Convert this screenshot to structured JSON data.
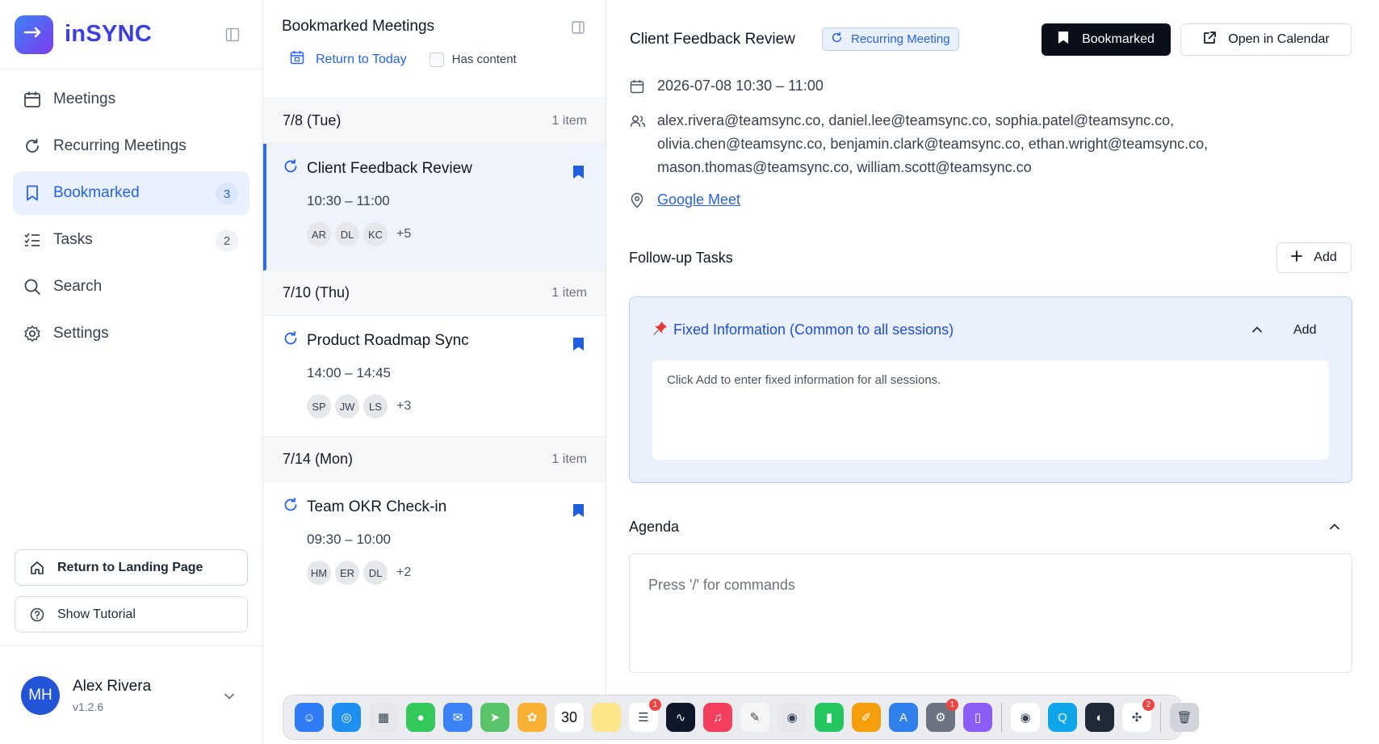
{
  "app": {
    "name": "inSYNC"
  },
  "sidebar": {
    "items": [
      {
        "label": "Meetings",
        "icon": "calendar-icon"
      },
      {
        "label": "Recurring Meetings",
        "icon": "refresh-icon"
      },
      {
        "label": "Bookmarked",
        "icon": "bookmark-icon",
        "badge": "3",
        "active": true
      },
      {
        "label": "Tasks",
        "icon": "checklist-icon",
        "badge": "2"
      },
      {
        "label": "Search",
        "icon": "search-icon"
      },
      {
        "label": "Settings",
        "icon": "gear-icon"
      }
    ],
    "landing_label": "Return to Landing Page",
    "tutorial_label": "Show Tutorial",
    "user": {
      "initials": "MH",
      "name": "Alex Rivera",
      "version": "v1.2.6"
    }
  },
  "list": {
    "title": "Bookmarked Meetings",
    "today_label": "Return to Today",
    "has_content_label": "Has content",
    "groups": [
      {
        "date": "7/8 (Tue)",
        "count": "1 item",
        "meeting": {
          "title": "Client Feedback Review",
          "time": "10:30 – 11:00",
          "avatars": [
            "AR",
            "DL",
            "KC"
          ],
          "more": "+5"
        }
      },
      {
        "date": "7/10 (Thu)",
        "count": "1 item",
        "meeting": {
          "title": "Product Roadmap Sync",
          "time": "14:00 – 14:45",
          "avatars": [
            "SP",
            "JW",
            "LS"
          ],
          "more": "+3"
        }
      },
      {
        "date": "7/14 (Mon)",
        "count": "1 item",
        "meeting": {
          "title": "Team OKR Check-in",
          "time": "09:30 – 10:00",
          "avatars": [
            "HM",
            "ER",
            "DL"
          ],
          "more": "+2"
        }
      }
    ]
  },
  "detail": {
    "title": "Client Feedback Review",
    "recurring_label": "Recurring Meeting",
    "bookmarked_label": "Bookmarked",
    "open_calendar_label": "Open in Calendar",
    "datetime": "2026-07-08 10:30 – 11:00",
    "attendees": [
      "alex.rivera@teamsync.co, daniel.lee@teamsync.co, sophia.patel@teamsync.co,",
      "olivia.chen@teamsync.co, benjamin.clark@teamsync.co, ethan.wright@teamsync.co,",
      "mason.thomas@teamsync.co, william.scott@teamsync.co"
    ],
    "location": "Google Meet",
    "followup_title": "Follow-up Tasks",
    "add_label": "Add",
    "fixed_title": "Fixed Information (Common to all sessions)",
    "fixed_add_label": "Add",
    "fixed_placeholder": "Click Add to enter fixed information for all sessions.",
    "agenda_title": "Agenda",
    "agenda_placeholder": "Press '/' for commands"
  },
  "dock": {
    "apps": [
      {
        "name": "finder-icon",
        "color": "#2f7cf6",
        "glyph": "☺"
      },
      {
        "name": "safari-icon",
        "color": "#1e8ff0",
        "glyph": "◎"
      },
      {
        "name": "launchpad-icon",
        "color": "#e5e7eb",
        "glyph": "▦"
      },
      {
        "name": "messages-icon",
        "color": "#34c759",
        "glyph": "●"
      },
      {
        "name": "mail-icon",
        "color": "#3b82f6",
        "glyph": "✉"
      },
      {
        "name": "maps-icon",
        "color": "#5ac46b",
        "glyph": "➤"
      },
      {
        "name": "photos-icon",
        "color": "#f8b133",
        "glyph": "✿"
      },
      {
        "name": "calendar-app-icon",
        "color": "#ffffff",
        "glyph": "30"
      },
      {
        "name": "notes-icon",
        "color": "#fde68a",
        "glyph": ""
      },
      {
        "name": "reminders-icon",
        "color": "#ffffff",
        "glyph": "☰",
        "badge": "1"
      },
      {
        "name": "stocks-icon",
        "color": "#0f172a",
        "glyph": "∿"
      },
      {
        "name": "music-icon",
        "color": "#f43f5e",
        "glyph": "♫"
      },
      {
        "name": "freeform-icon",
        "color": "#f5f5f5",
        "glyph": "✎"
      },
      {
        "name": "screenshot-icon",
        "color": "#e5e7eb",
        "glyph": "◉"
      },
      {
        "name": "numbers-icon",
        "color": "#22c55e",
        "glyph": "▮"
      },
      {
        "name": "pages-icon",
        "color": "#f59e0b",
        "glyph": "✐"
      },
      {
        "name": "appstore-icon",
        "color": "#2f80ed",
        "glyph": "A"
      },
      {
        "name": "system-settings-icon",
        "color": "#6b7280",
        "glyph": "⚙",
        "badge": "1"
      },
      {
        "name": "preview-icon",
        "color": "#8b5cf6",
        "glyph": "▯"
      },
      {
        "name": "chrome-icon",
        "color": "#ffffff",
        "glyph": "◉"
      },
      {
        "name": "quicktime-icon",
        "color": "#0ea5e9",
        "glyph": "Q"
      },
      {
        "name": "camera-app-icon",
        "color": "#1f2937",
        "glyph": "◐"
      },
      {
        "name": "slack-icon",
        "color": "#ffffff",
        "glyph": "✣",
        "badge": "2"
      },
      {
        "name": "trash-icon",
        "color": "#d1d5db",
        "glyph": "🗑"
      }
    ]
  }
}
